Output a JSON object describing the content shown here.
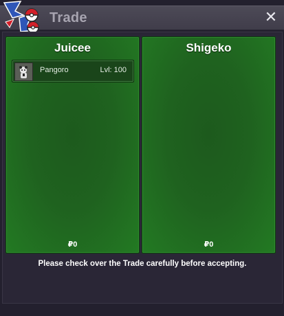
{
  "window": {
    "title": "Trade",
    "close_label": "✕"
  },
  "trade": {
    "left": {
      "player": "Juicee",
      "items": [
        {
          "pokemon": "Pangoro",
          "level_label": "Lvl: 100"
        }
      ],
      "money": "₽0"
    },
    "right": {
      "player": "Shigeko",
      "items": [],
      "money": "₽0"
    },
    "notice": "Please check over the Trade carefully before accepting."
  },
  "icons": {
    "logo": "pokeball-wing-logo-icon",
    "close": "close-icon",
    "pokemon": "pangoro-icon"
  },
  "colors": {
    "panel_green": "#1f621f",
    "title_text": "#a7a4b0",
    "background": "#23202e"
  }
}
